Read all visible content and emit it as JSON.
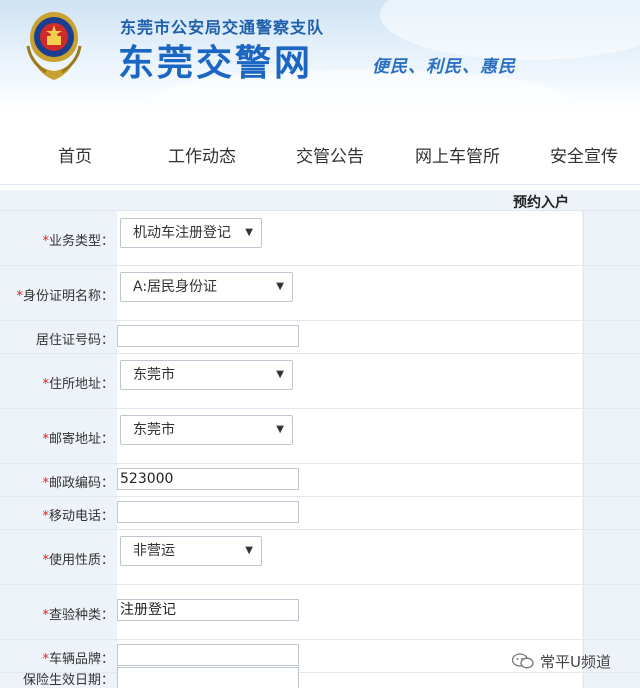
{
  "header": {
    "subtitle": "东莞市公安局交通警察支队",
    "site_name": "东莞交警网",
    "slogan": "便民、利民、惠民"
  },
  "nav": {
    "items": [
      "首页",
      "工作动态",
      "交管公告",
      "网上车管所",
      "安全宣传"
    ]
  },
  "form": {
    "title": "预约入户",
    "fields": [
      {
        "label": "*业务类型：",
        "type": "select",
        "value": "机动车注册登记"
      },
      {
        "label": "*身份证明名称：",
        "type": "select",
        "value": "A:居民身份证"
      },
      {
        "label": "居住证号码：",
        "type": "input",
        "value": ""
      },
      {
        "label": "*住所地址：",
        "type": "select",
        "value": "东莞市"
      },
      {
        "label": "*邮寄地址：",
        "type": "select",
        "value": "东莞市"
      },
      {
        "label": "*邮政编码：",
        "type": "input",
        "value": "523000"
      },
      {
        "label": "*移动电话：",
        "type": "input",
        "value": ""
      },
      {
        "label": "*使用性质：",
        "type": "select",
        "value": "非营运"
      },
      {
        "label": "*查验种类：",
        "type": "input",
        "value": "注册登记"
      },
      {
        "label": "*车辆品牌：",
        "type": "input",
        "value": ""
      },
      {
        "label": "保险生效日期：",
        "type": "input",
        "value": ""
      }
    ]
  },
  "watermark": {
    "text": "常平U频道"
  },
  "colors": {
    "brand_blue": "#1a66c2",
    "required_red": "#e02020",
    "row_bg": "#eef3f9"
  }
}
